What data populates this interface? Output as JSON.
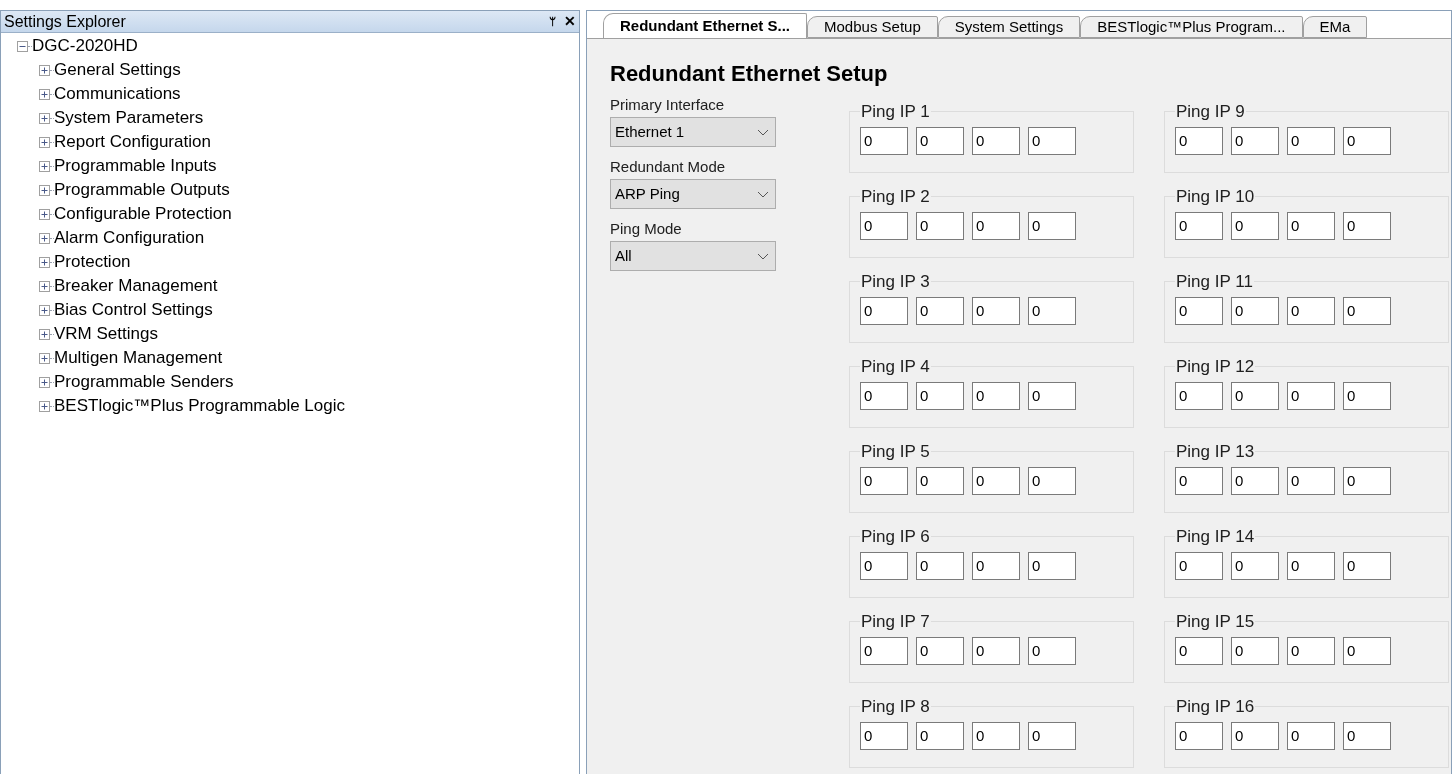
{
  "explorer": {
    "title": "Settings Explorer",
    "pin": "ᛘ",
    "close": "✕",
    "tree": [
      {
        "label": "DGC-2020HD",
        "expanded": true,
        "children": [
          {
            "label": "General Settings",
            "expanded": false
          },
          {
            "label": "Communications",
            "expanded": false
          },
          {
            "label": "System Parameters",
            "expanded": false
          },
          {
            "label": "Report Configuration",
            "expanded": false
          },
          {
            "label": "Programmable Inputs",
            "expanded": false
          },
          {
            "label": "Programmable Outputs",
            "expanded": false
          },
          {
            "label": "Configurable Protection",
            "expanded": false
          },
          {
            "label": "Alarm Configuration",
            "expanded": false
          },
          {
            "label": "Protection",
            "expanded": false
          },
          {
            "label": "Breaker Management",
            "expanded": false
          },
          {
            "label": "Bias Control Settings",
            "expanded": false
          },
          {
            "label": "VRM Settings",
            "expanded": false
          },
          {
            "label": "Multigen Management",
            "expanded": false
          },
          {
            "label": "Programmable Senders",
            "expanded": false
          },
          {
            "label": "BESTlogic™Plus Programmable Logic",
            "expanded": false
          }
        ]
      }
    ]
  },
  "tabs": [
    {
      "label": "Redundant Ethernet S...",
      "selected": true
    },
    {
      "label": "Modbus Setup",
      "selected": false
    },
    {
      "label": "System Settings",
      "selected": false
    },
    {
      "label": "BESTlogic™Plus Program...",
      "selected": false
    },
    {
      "label": "EMa",
      "selected": false
    }
  ],
  "page_title": "Redundant Ethernet Setup",
  "settings": [
    {
      "label": "Primary Interface",
      "value": "Ethernet 1"
    },
    {
      "label": "Redundant Mode",
      "value": "ARP Ping"
    },
    {
      "label": "Ping Mode",
      "value": "All"
    }
  ],
  "ping_columns": [
    [
      {
        "title": "Ping IP 1",
        "octets": [
          "0",
          "0",
          "0",
          "0"
        ]
      },
      {
        "title": "Ping IP 2",
        "octets": [
          "0",
          "0",
          "0",
          "0"
        ]
      },
      {
        "title": "Ping IP 3",
        "octets": [
          "0",
          "0",
          "0",
          "0"
        ]
      },
      {
        "title": "Ping IP 4",
        "octets": [
          "0",
          "0",
          "0",
          "0"
        ]
      },
      {
        "title": "Ping IP 5",
        "octets": [
          "0",
          "0",
          "0",
          "0"
        ]
      },
      {
        "title": "Ping IP 6",
        "octets": [
          "0",
          "0",
          "0",
          "0"
        ]
      },
      {
        "title": "Ping IP 7",
        "octets": [
          "0",
          "0",
          "0",
          "0"
        ]
      },
      {
        "title": "Ping IP 8",
        "octets": [
          "0",
          "0",
          "0",
          "0"
        ]
      }
    ],
    [
      {
        "title": "Ping IP 9",
        "octets": [
          "0",
          "0",
          "0",
          "0"
        ]
      },
      {
        "title": "Ping IP 10",
        "octets": [
          "0",
          "0",
          "0",
          "0"
        ]
      },
      {
        "title": "Ping IP 11",
        "octets": [
          "0",
          "0",
          "0",
          "0"
        ]
      },
      {
        "title": "Ping IP 12",
        "octets": [
          "0",
          "0",
          "0",
          "0"
        ]
      },
      {
        "title": "Ping IP 13",
        "octets": [
          "0",
          "0",
          "0",
          "0"
        ]
      },
      {
        "title": "Ping IP 14",
        "octets": [
          "0",
          "0",
          "0",
          "0"
        ]
      },
      {
        "title": "Ping IP 15",
        "octets": [
          "0",
          "0",
          "0",
          "0"
        ]
      },
      {
        "title": "Ping IP 16",
        "octets": [
          "0",
          "0",
          "0",
          "0"
        ]
      }
    ]
  ]
}
